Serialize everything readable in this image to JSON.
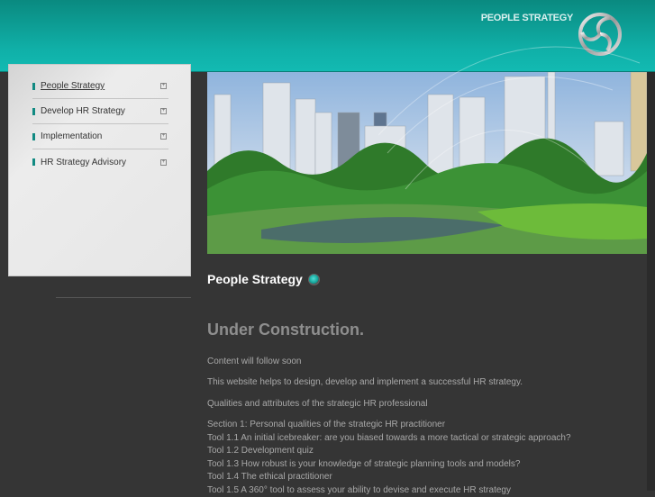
{
  "header": {
    "brand": "PEOPLE STRATEGY",
    "logo_icon": "silver-triskelion-logo",
    "color": "#10b0a8"
  },
  "sidebar": {
    "items": [
      {
        "label": "People Strategy",
        "active": true
      },
      {
        "label": "Develop HR Strategy"
      },
      {
        "label": "Implementation"
      },
      {
        "label": "HR Strategy Advisory"
      }
    ],
    "expand_icon": "plus-box-icon"
  },
  "hero": {
    "image": "city-skyline-park-photo"
  },
  "content": {
    "title": "People Strategy",
    "heading": "Under Construction.",
    "paragraphs": [
      "Content will follow soon",
      "This website helps to design, develop and implement a successful HR strategy.",
      "Qualities and attributes of the strategic HR professional"
    ],
    "list": [
      "Section 1: Personal qualities of the strategic HR practitioner",
      "Tool 1.1 An initial icebreaker: are you biased towards a more tactical or strategic approach?",
      "Tool 1.2 Development quiz",
      "Tool 1.3 How robust is your knowledge of strategic planning tools and models?",
      "Tool 1.4 The ethical practitioner",
      "Tool 1.5 A 360° tool to assess your ability to devise and execute HR strategy"
    ]
  }
}
